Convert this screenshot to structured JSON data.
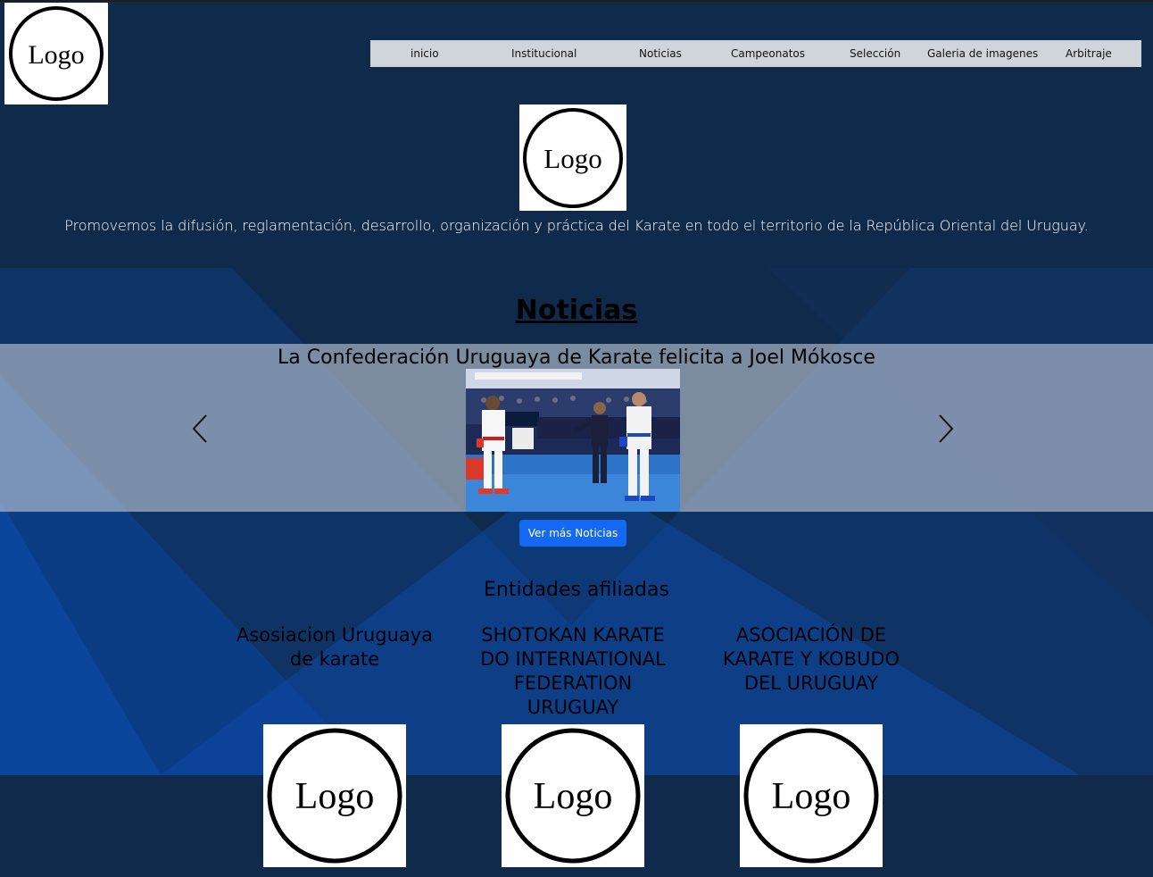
{
  "header": {
    "logo_text": "Logo"
  },
  "nav": {
    "items": [
      {
        "label": "inicio"
      },
      {
        "label": "Institucional"
      },
      {
        "label": "Noticias"
      },
      {
        "label": "Campeonatos"
      },
      {
        "label": "Selección"
      },
      {
        "label": "Galeria de imagenes"
      },
      {
        "label": "Arbitraje"
      }
    ]
  },
  "hero": {
    "logo_text": "Logo",
    "tagline": "Promovemos la difusión, reglamentación, desarrollo, organización y práctica del Karate en todo el territorio de la República Oriental del Uruguay."
  },
  "news": {
    "heading": "Noticias",
    "slide_title": "La Confederación Uruguaya de Karate felicita a Joel Mókosce",
    "more_button": "Ver más Noticias"
  },
  "affiliates": {
    "heading": "Entidades afiliadas",
    "items": [
      {
        "name": "Asosiacion Uruguaya de karate",
        "logo_text": "Logo"
      },
      {
        "name": "SHOTOKAN KARATE DO INTERNATIONAL FEDERATION URUGUAY",
        "logo_text": "Logo"
      },
      {
        "name": "ASOCIACIÓN DE KARATE Y KOBUDO DEL URUGUAY",
        "logo_text": "Logo"
      }
    ]
  },
  "colors": {
    "background": "#0f2a4a",
    "nav_bg": "#d0d5dc",
    "button": "#1468f2"
  }
}
